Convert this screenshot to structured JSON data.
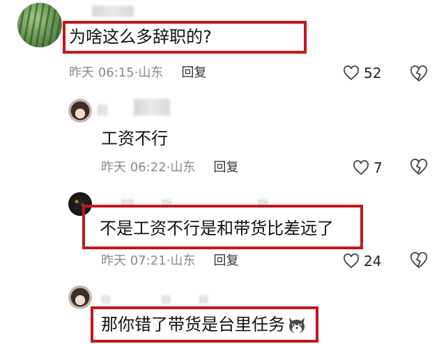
{
  "comments": [
    {
      "text": "为啥这么多辞职的?",
      "time": "昨天 06:15",
      "location": "山东",
      "reply_label": "回复",
      "likes": "52"
    },
    {
      "text": "工资不行",
      "time": "昨天 06:22",
      "location": "山东",
      "reply_label": "回复",
      "likes": "7"
    },
    {
      "text": "不是工资不行是和带货比差远了",
      "time": "昨天 07:21",
      "location": "山东",
      "reply_label": "回复",
      "likes": "24"
    },
    {
      "text": "那你错了带货是台里任务"
    }
  ],
  "icons": {
    "like": "heart-outline-icon",
    "dislike": "broken-heart-icon",
    "emoji": "wolf-emoji-icon"
  },
  "colors": {
    "highlight_box": "#c4161c",
    "meta_text": "#8a8a8a"
  }
}
